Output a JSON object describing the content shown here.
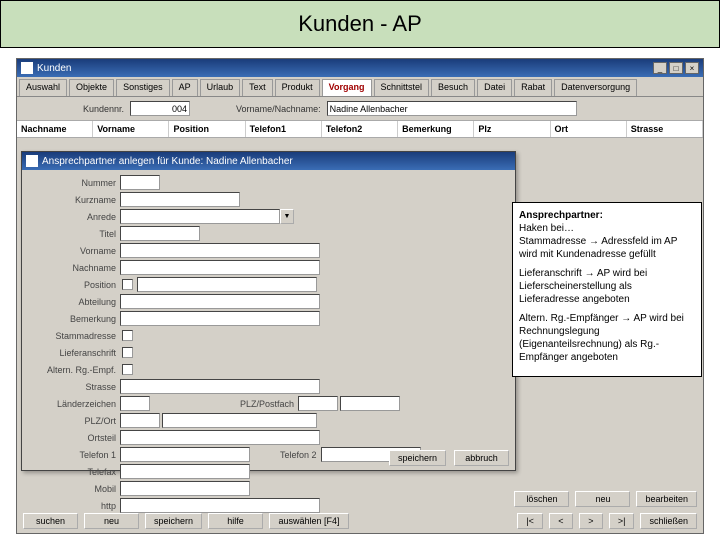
{
  "slide_title": "Kunden - AP",
  "main_window": {
    "title": "Kunden",
    "tabs": [
      "Auswahl",
      "Objekte",
      "Sonstiges",
      "AP",
      "Urlaub",
      "Text",
      "Produkt",
      "Vorgang",
      "Schnittstel",
      "Besuch",
      "Datei",
      "Rabat",
      "Datenversorgung"
    ],
    "active_tab": "Vorgang",
    "kundennr_label": "Kundennr.",
    "kundennr_value": "004",
    "vorname_nachname_label": "Vorname/Nachname:",
    "vorname_nachname_value": "Nadine Allenbacher",
    "columns": [
      "Nachname",
      "Vorname",
      "Position",
      "Telefon1",
      "Telefon2",
      "Bemerkung",
      "Plz",
      "Ort",
      "Strasse"
    ]
  },
  "modal": {
    "title": "Ansprechpartner anlegen für Kunde: Nadine Allenbacher",
    "fields": {
      "nummer": "Nummer",
      "kurzname": "Kurzname",
      "anrede": "Anrede",
      "titel": "Titel",
      "vorname": "Vorname",
      "nachname": "Nachname",
      "position": "Position",
      "abteilung": "Abteilung",
      "bemerkung": "Bemerkung",
      "stammadresse": "Stammadresse",
      "lieferanschrift": "Lieferanschrift",
      "altern_rg_empf": "Altern. Rg.-Empf.",
      "strasse": "Strasse",
      "laenderzeichen": "Länderzeichen",
      "plz_ort": "PLZ/Ort",
      "ortsteil": "Ortsteil",
      "telefon1": "Telefon 1",
      "telefax": "Telefax",
      "mobil": "Mobil",
      "http": "http",
      "plz_postfach": "PLZ/Postfach",
      "telefon2": "Telefon 2"
    },
    "buttons": {
      "speichern": "speichern",
      "abbruch": "abbruch"
    }
  },
  "callout": {
    "title": "Ansprechpartner:",
    "p1": "Haken bei…",
    "p2": "Stammadresse → Adressfeld im AP wird mit Kundenadresse gefüllt",
    "p3": "Lieferanschrift → AP wird bei Lieferscheinerstellung als Lieferadresse angeboten",
    "p4": "Altern. Rg.-Empfänger → AP wird bei Rechnungslegung (Eigenanteilsrechnung) als Rg.-Empfänger angeboten"
  },
  "bottom_bar": {
    "loeschen": "löschen",
    "neu": "neu",
    "bearbeiten": "bearbeiten",
    "suchen": "suchen",
    "neu2": "neu",
    "speichern": "speichern",
    "hilfe": "hilfe",
    "auswaehlen": "auswählen [F4]",
    "nav_first": "|<",
    "nav_prev": "<",
    "nav_next": ">",
    "nav_last": ">|",
    "schliessen": "schließen"
  }
}
